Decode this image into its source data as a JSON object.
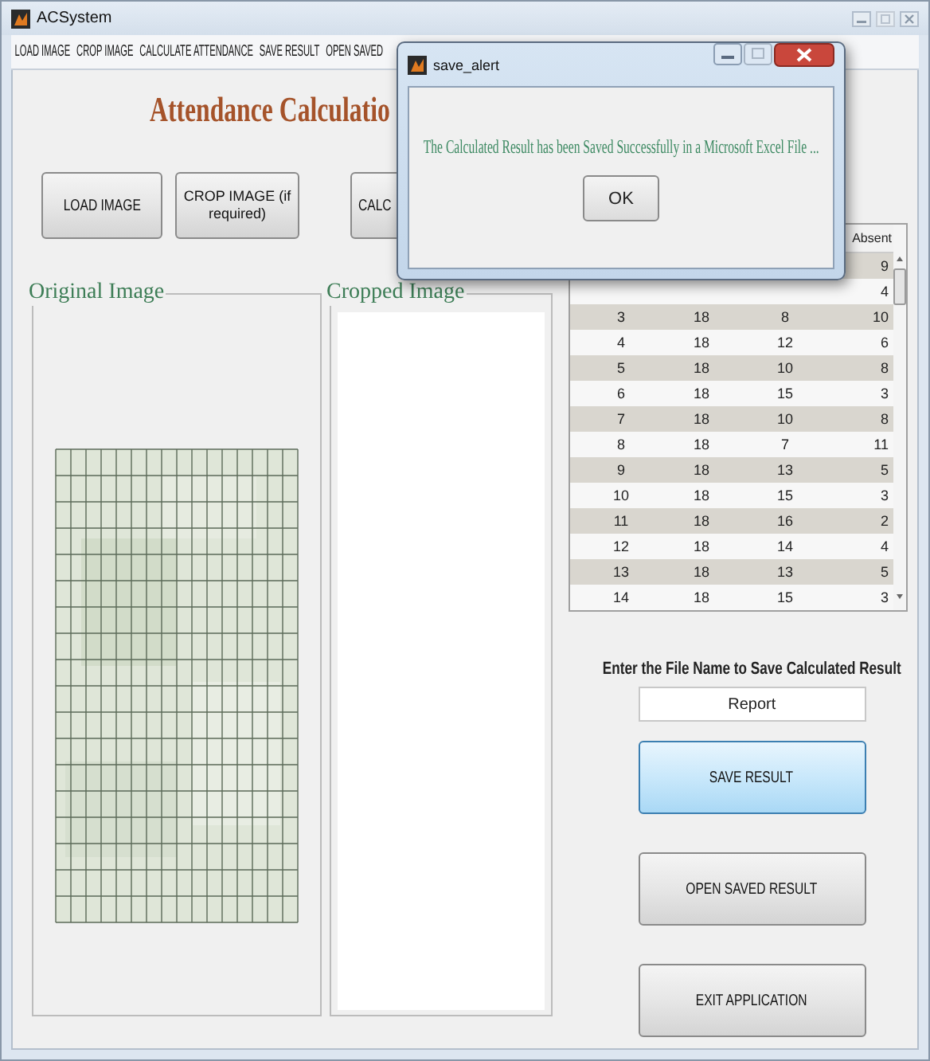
{
  "main_window": {
    "title": "ACSystem"
  },
  "menu": [
    "LOAD IMAGE",
    "CROP IMAGE",
    "CALCULATE ATTENDANCE",
    "SAVE RESULT",
    "OPEN SAVED"
  ],
  "heading": "Attendance Calculatio",
  "toolbar_buttons": [
    "LOAD IMAGE",
    "CROP IMAGE (if required)",
    "CALC"
  ],
  "panels": [
    {
      "title": "Original Image"
    },
    {
      "title": "Cropped Image"
    }
  ],
  "table": {
    "headers": {
      "column_4": "Absent"
    },
    "rows": [
      {
        "column_4": "9"
      },
      {
        "column_4": "4"
      },
      {
        "column_1": "3",
        "column_2": "18",
        "column_3": "8",
        "column_4": "10"
      },
      {
        "column_1": "4",
        "column_2": "18",
        "column_3": "12",
        "column_4": "6"
      },
      {
        "column_1": "5",
        "column_2": "18",
        "column_3": "10",
        "column_4": "8"
      },
      {
        "column_1": "6",
        "column_2": "18",
        "column_3": "15",
        "column_4": "3"
      },
      {
        "column_1": "7",
        "column_2": "18",
        "column_3": "10",
        "column_4": "8"
      },
      {
        "column_1": "8",
        "column_2": "18",
        "column_3": "7",
        "column_4": "11"
      },
      {
        "column_1": "9",
        "column_2": "18",
        "column_3": "13",
        "column_4": "5"
      },
      {
        "column_1": "10",
        "column_2": "18",
        "column_3": "15",
        "column_4": "3"
      },
      {
        "column_1": "11",
        "column_2": "18",
        "column_3": "16",
        "column_4": "2"
      },
      {
        "column_1": "12",
        "column_2": "18",
        "column_3": "14",
        "column_4": "4"
      },
      {
        "column_1": "13",
        "column_2": "18",
        "column_3": "13",
        "column_4": "5"
      },
      {
        "column_1": "14",
        "column_2": "18",
        "column_3": "15",
        "column_4": "3"
      }
    ]
  },
  "file_name": {
    "label": "Enter the File Name to Save Calculated Result",
    "value": "Report"
  },
  "action_buttons": [
    {
      "label": "SAVE RESULT",
      "focused": true
    },
    {
      "label": "OPEN SAVED RESULT",
      "focused": false
    },
    {
      "label": "EXIT APPLICATION",
      "focused": false
    }
  ],
  "dialog": {
    "title": "save_alert",
    "message": "The Calculated Result has been Saved Successfully in a Microsoft Excel File ...",
    "button": "OK"
  }
}
